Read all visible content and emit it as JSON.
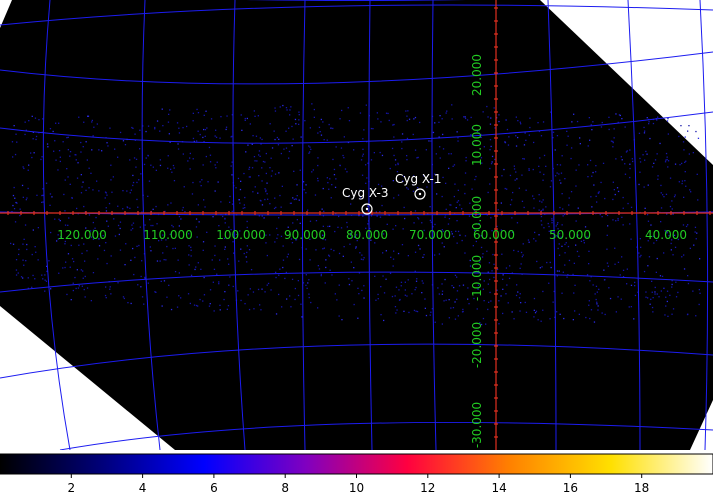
{
  "image": {
    "background_outside": "#ffffff",
    "image_fill": "#000000",
    "grid_color": "#1c1cf0",
    "axis_color": "#e03020",
    "label_color": "#22cc22",
    "marker_color": "#ffffff"
  },
  "sources": [
    {
      "name": "Cyg X-1"
    },
    {
      "name": "Cyg X-3"
    }
  ],
  "longitude_labels": [
    "120.000",
    "110.000",
    "100.000",
    "90.000",
    "80.000",
    "70.000",
    "60.000",
    "50.000",
    "40.000"
  ],
  "latitude_labels": [
    "20.000",
    "10.000",
    "0.000",
    "-10.000",
    "-20.000",
    "-30.000"
  ],
  "colorbar": {
    "tick_labels": [
      "2",
      "4",
      "6",
      "8",
      "10",
      "12",
      "14",
      "16",
      "18"
    ],
    "colormap": [
      "#000000",
      "#00007a",
      "#0000ff",
      "#8000c0",
      "#ff0040",
      "#ff8000",
      "#ffe000",
      "#ffffff"
    ]
  }
}
